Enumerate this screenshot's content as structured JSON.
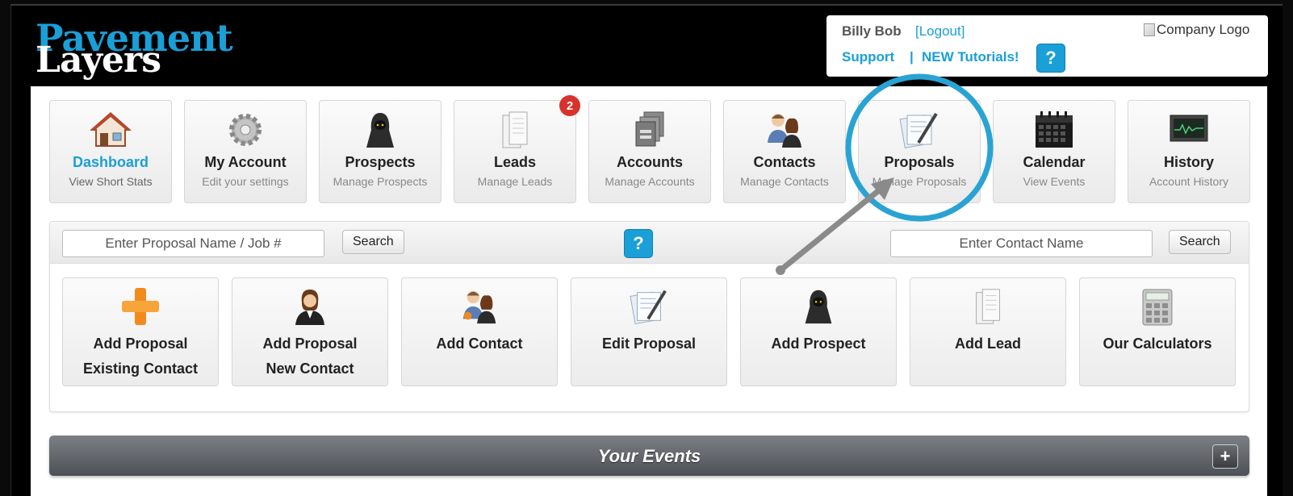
{
  "header": {
    "logo_top": "Pavement",
    "logo_bottom": "Layers",
    "user_name": "Billy Bob",
    "logout_label": "[Logout]",
    "support_label": "Support",
    "separator": "|",
    "tutorials_label": "NEW Tutorials!",
    "help_label": "?",
    "company_logo_alt": "Company Logo"
  },
  "nav": [
    {
      "title": "Dashboard",
      "subtitle": "View Short Stats",
      "icon": "house-icon",
      "active": true
    },
    {
      "title": "My Account",
      "subtitle": "Edit your settings",
      "icon": "gear-icon"
    },
    {
      "title": "Prospects",
      "subtitle": "Manage Prospects",
      "icon": "hooded-figure-icon"
    },
    {
      "title": "Leads",
      "subtitle": "Manage Leads",
      "icon": "documents-icon",
      "badge": "2"
    },
    {
      "title": "Accounts",
      "subtitle": "Manage Accounts",
      "icon": "folders-icon"
    },
    {
      "title": "Contacts",
      "subtitle": "Manage Contacts",
      "icon": "people-icon"
    },
    {
      "title": "Proposals",
      "subtitle": "Manage Proposals",
      "icon": "document-pen-icon"
    },
    {
      "title": "Calendar",
      "subtitle": "View Events",
      "icon": "calendar-icon"
    },
    {
      "title": "History",
      "subtitle": "Account History",
      "icon": "monitor-chart-icon"
    }
  ],
  "search": {
    "proposal_placeholder": "Enter Proposal Name / Job #",
    "proposal_button": "Search",
    "help_label": "?",
    "contact_placeholder": "Enter Contact Name",
    "contact_button": "Search"
  },
  "quick_actions": [
    {
      "line1": "Add Proposal",
      "line2": "Existing Contact",
      "icon": "orange-plus-icon"
    },
    {
      "line1": "Add Proposal",
      "line2": "New Contact",
      "icon": "businesswoman-icon"
    },
    {
      "line1": "Add Contact",
      "line2": "",
      "icon": "people-icon"
    },
    {
      "line1": "Edit Proposal",
      "line2": "",
      "icon": "document-pen-icon"
    },
    {
      "line1": "Add Prospect",
      "line2": "",
      "icon": "hooded-figure-icon"
    },
    {
      "line1": "Add Lead",
      "line2": "",
      "icon": "documents-icon"
    },
    {
      "line1": "Our Calculators",
      "line2": "",
      "icon": "calculator-icon"
    }
  ],
  "events": {
    "title": "Your Events",
    "toggle_label": "+"
  },
  "colors": {
    "accent": "#1a9fd6",
    "badge": "#d7322b",
    "annotation": "#29a3d4",
    "arrow": "#8a8a8a"
  }
}
